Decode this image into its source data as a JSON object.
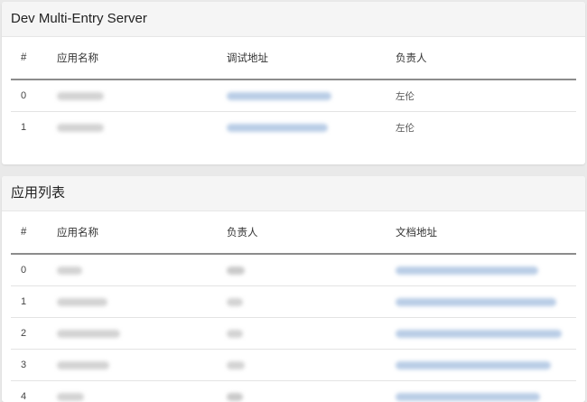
{
  "server_card": {
    "title": "Dev Multi-Entry Server",
    "columns": [
      "#",
      "应用名称",
      "调试地址",
      "负责人"
    ],
    "rows": [
      {
        "index": "0",
        "owner": "左伦"
      },
      {
        "index": "1",
        "owner": "左伦"
      }
    ]
  },
  "apps_card": {
    "title": "应用列表",
    "columns": [
      "#",
      "应用名称",
      "负责人",
      "文档地址"
    ],
    "rows": [
      {
        "index": "0"
      },
      {
        "index": "1"
      },
      {
        "index": "2"
      },
      {
        "index": "3"
      },
      {
        "index": "4"
      }
    ]
  },
  "colors": {
    "link_blur": "#b9cde6",
    "text_blur": "#c9c9c9",
    "header_bg": "#f5f5f5"
  }
}
